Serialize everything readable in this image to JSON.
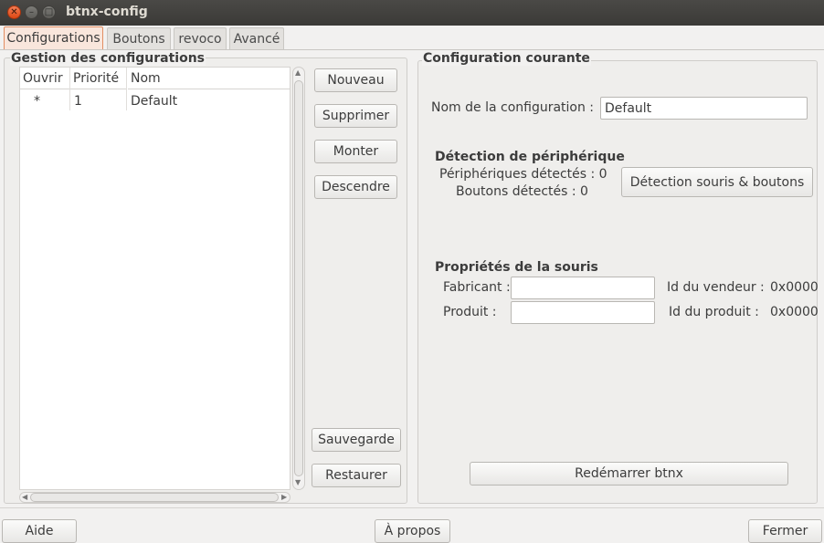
{
  "window": {
    "title": "btnx-config"
  },
  "tabs": [
    {
      "label": "Configurations",
      "active": true
    },
    {
      "label": "Boutons",
      "active": false
    },
    {
      "label": "revoco",
      "active": false
    },
    {
      "label": "Avancé",
      "active": false
    }
  ],
  "config_management": {
    "title": "Gestion des configurations",
    "columns": [
      "Ouvrir",
      "Priorité",
      "Nom"
    ],
    "rows": [
      {
        "open": "*",
        "priority": "1",
        "name": "Default"
      }
    ],
    "buttons": {
      "new": "Nouveau",
      "delete": "Supprimer",
      "up": "Monter",
      "down": "Descendre",
      "save": "Sauvegarde",
      "restore": "Restaurer"
    }
  },
  "current_config": {
    "title": "Configuration courante",
    "name_label": "Nom de la configuration :",
    "name_value": "Default",
    "detection": {
      "title": "Détection de périphérique",
      "devices_label": "Périphériques détectés : 0",
      "buttons_label": "Boutons détectés : 0",
      "detect_button": "Détection souris & boutons"
    },
    "mouse": {
      "title": "Propriétés de la souris",
      "maker_label": "Fabricant :",
      "maker_value": "",
      "product_label": "Produit :",
      "product_value": "",
      "vendor_id_label": "Id du vendeur :",
      "vendor_id_value": "0x0000",
      "product_id_label": "Id du produit :",
      "product_id_value": "0x0000"
    },
    "restart_button": "Redémarrer btnx"
  },
  "footer": {
    "help": "Aide",
    "about": "À propos",
    "close": "Fermer"
  },
  "colors": {
    "accent": "#e28e62",
    "titlebar": "#3c3b37",
    "close": "#dd4814"
  },
  "icons": [
    "close-icon",
    "minimize-icon",
    "maximize-icon",
    "scroll-up-arrow-icon",
    "scroll-down-arrow-icon",
    "scroll-left-arrow-icon",
    "scroll-right-arrow-icon"
  ]
}
